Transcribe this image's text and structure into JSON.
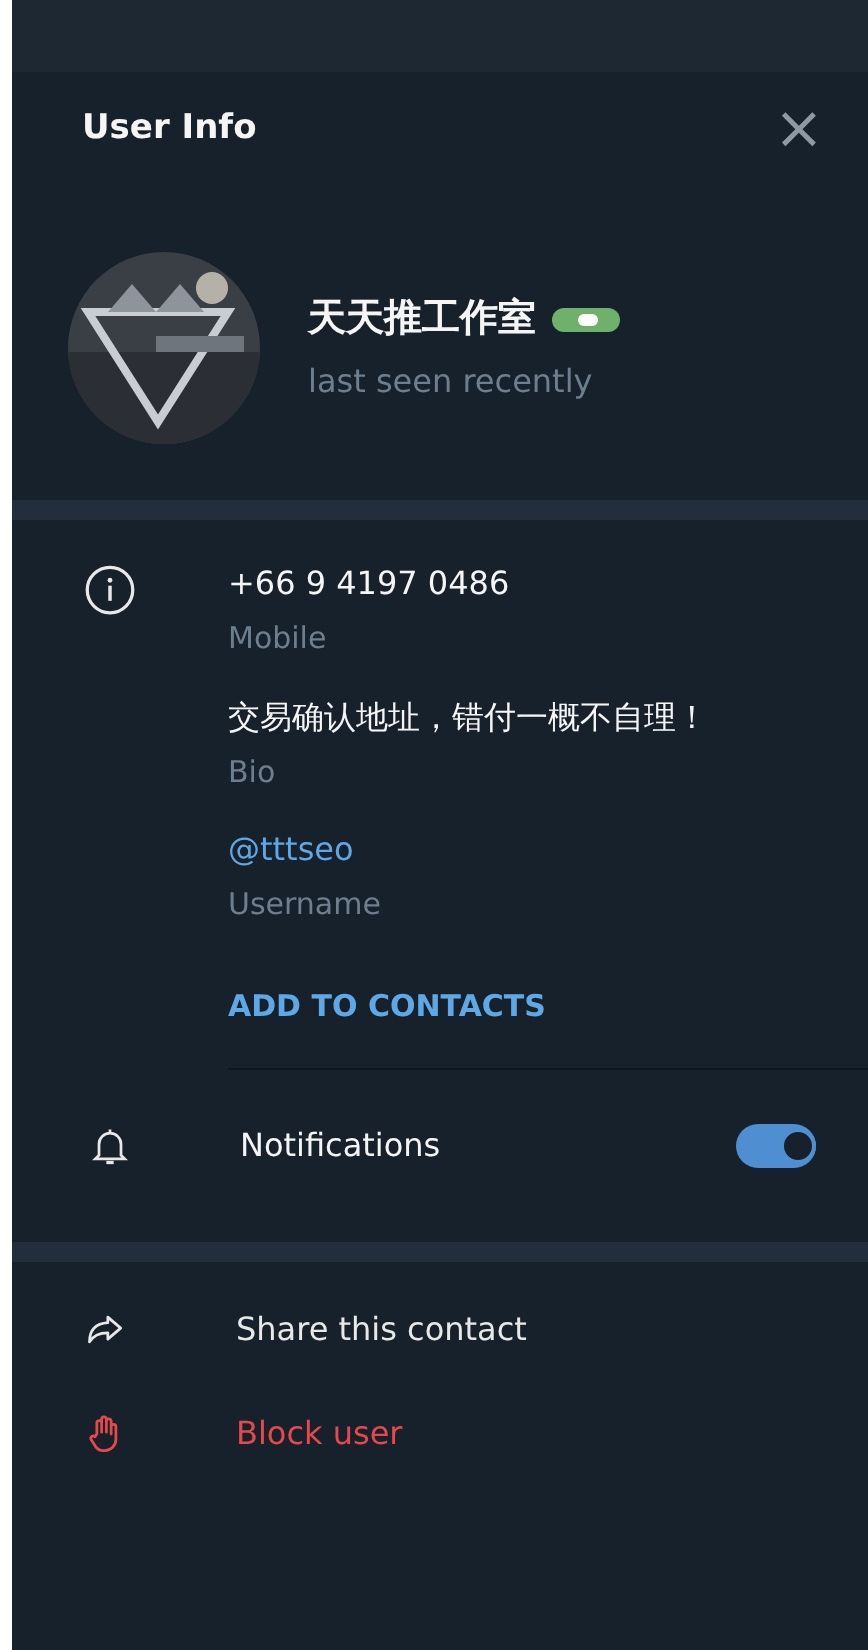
{
  "header": {
    "title": "User Info",
    "close": "×"
  },
  "profile": {
    "name": "天天推工作室",
    "status": "last seen recently"
  },
  "info": [
    {
      "kind": "phone",
      "value": "+66 9 4197 0486",
      "label": "Mobile"
    },
    {
      "kind": "bio",
      "value": "交易确认地址，错付一概不自理！",
      "label": "Bio"
    },
    {
      "kind": "username",
      "value": "@tttseo",
      "label": "Username"
    }
  ],
  "add_contact": "ADD TO CONTACTS",
  "notifications": {
    "label": "Notifications",
    "on": true
  },
  "actions": [
    {
      "kind": "share",
      "label": "Share this contact"
    },
    {
      "kind": "block",
      "label": "Block user"
    }
  ]
}
